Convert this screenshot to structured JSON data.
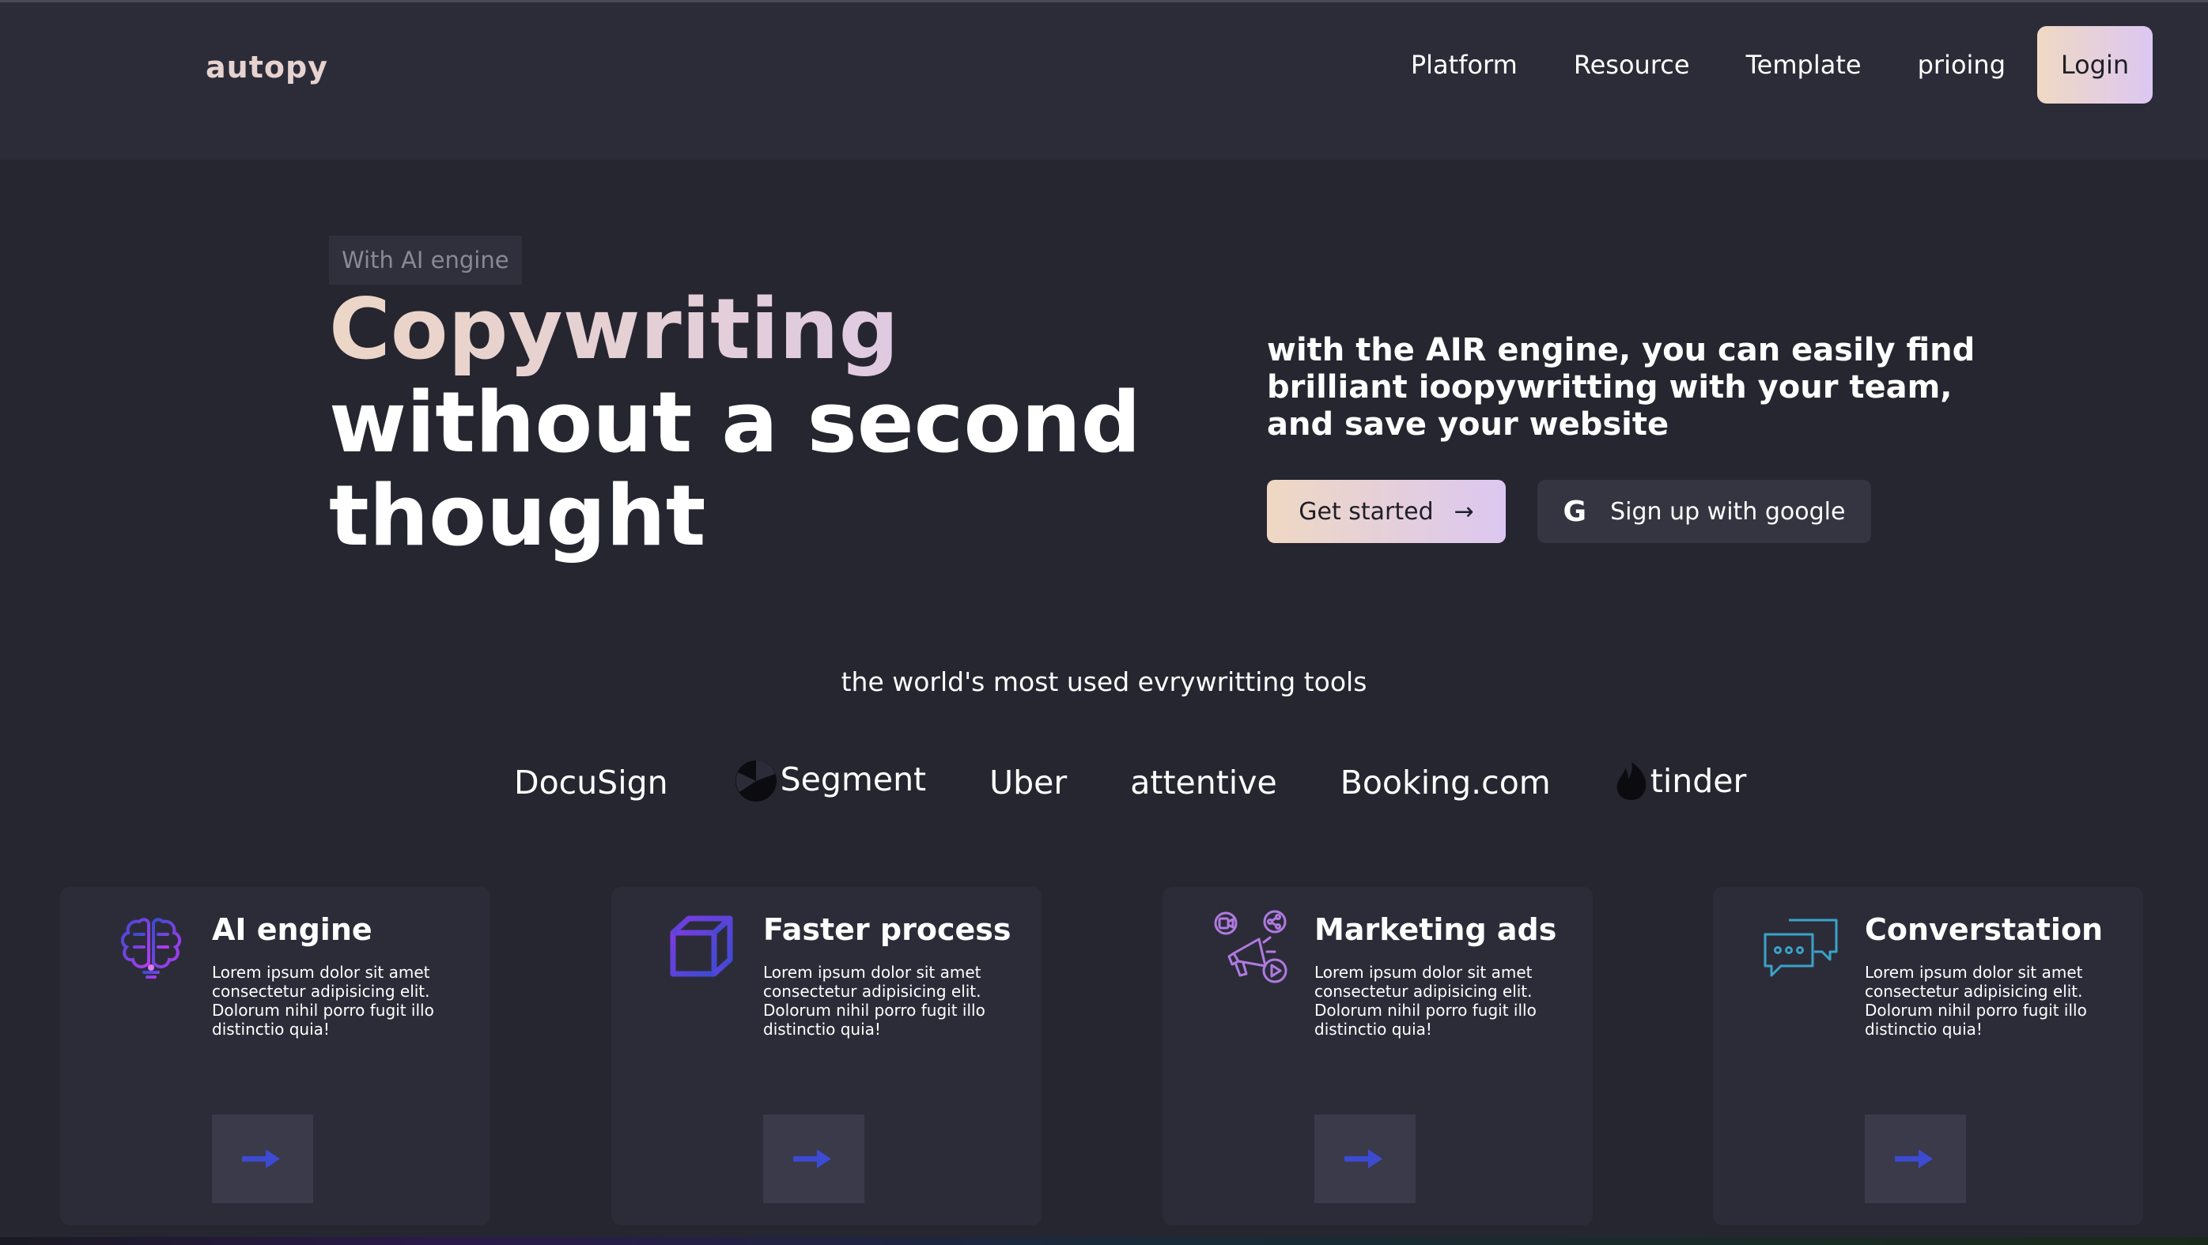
{
  "header": {
    "brand": "autopy",
    "nav": [
      "Platform",
      "Resource",
      "Template",
      "prioing"
    ],
    "login": "Login"
  },
  "hero": {
    "tag": "With AI engine",
    "title_line1": "Copywriting",
    "title_line2": "without a second",
    "title_line3": "thought",
    "description": "with the AIR engine, you can easily find brilliant ioopywritting with your team, and save your website",
    "get_started": "Get started",
    "get_started_arrow": "→",
    "google_icon": "G",
    "google_signup": "Sign up with google"
  },
  "tools": {
    "heading": "the world's most used evrywritting tools",
    "logos": [
      "DocuSign",
      "Segment",
      "Uber",
      "attentive",
      "Booking.com",
      "tinder"
    ]
  },
  "features": [
    {
      "title": "AI engine",
      "icon": "ai-brain-icon",
      "text": "Lorem ipsum dolor sit amet consectetur adipisicing elit. Dolorum nihil porro fugit illo distinctio quia!"
    },
    {
      "title": "Faster process",
      "icon": "cube-icon",
      "text": "Lorem ipsum dolor sit amet consectetur adipisicing elit. Dolorum nihil porro fugit illo distinctio quia!"
    },
    {
      "title": "Marketing ads",
      "icon": "megaphone-icon",
      "text": "Lorem ipsum dolor sit amet consectetur adipisicing elit. Dolorum nihil porro fugit illo distinctio quia!"
    },
    {
      "title": "Converstation",
      "icon": "chat-bubbles-icon",
      "text": "Lorem ipsum dolor sit amet consectetur adipisicing elit. Dolorum nihil porro fugit illo distinctio quia!"
    }
  ],
  "colors": {
    "background": "#262631",
    "header": "#2c2c39",
    "card": "#2c2c39",
    "accent_gradient_start": "#efd8c2",
    "accent_gradient_end": "#dcc7f1",
    "arrow_blue": "#3c4bd2"
  }
}
